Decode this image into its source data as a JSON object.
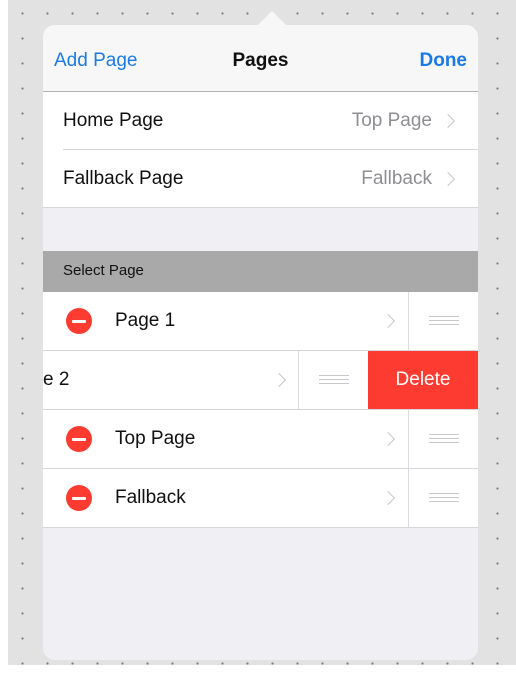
{
  "navbar": {
    "add_label": "Add Page",
    "title": "Pages",
    "done_label": "Done"
  },
  "settings": [
    {
      "label": "Home Page",
      "value": "Top Page"
    },
    {
      "label": "Fallback Page",
      "value": "Fallback"
    }
  ],
  "section": {
    "header": "Select Page"
  },
  "pages": [
    {
      "label": "Page 1",
      "state": "editing"
    },
    {
      "label": "e 2",
      "state": "swiped-to-delete"
    },
    {
      "label": "Top Page",
      "state": "editing"
    },
    {
      "label": "Fallback",
      "state": "editing"
    }
  ],
  "swipe_action": {
    "delete_label": "Delete"
  },
  "colors": {
    "accent": "#1a7ae8",
    "destructive": "#fd3b30",
    "section_header": "#a9a9a9",
    "group_background": "#efeff4"
  },
  "icons": {
    "minus": "delete-circle-icon",
    "chevron": "chevron-right-icon",
    "reorder": "reorder-grip-icon"
  }
}
